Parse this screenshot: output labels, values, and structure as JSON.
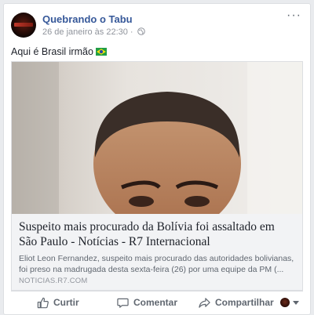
{
  "post": {
    "page_name": "Quebrando o Tabu",
    "timestamp": "26 de janeiro às 22:30",
    "separator": " · ",
    "audience_icon": "globe-icon",
    "caption": "Aqui é Brasil irmão",
    "caption_emoji": "brazil-flag-icon"
  },
  "link_card": {
    "title": "Suspeito mais procurado da Bolívia foi assaltado em São Paulo - Notícias - R7 Internacional",
    "description": "Eliot Leon Fernandez, suspeito mais procurado das autoridades bolivianas, foi preso na madrugada desta sexta-feira (26) por uma equipe da PM (...",
    "domain": "NOTICIAS.R7.COM"
  },
  "actions": {
    "like_label": "Curtir",
    "comment_label": "Comentar",
    "share_label": "Compartilhar"
  },
  "colors": {
    "link_blue": "#365899",
    "secondary_text": "#606770",
    "muted_text": "#90949c",
    "card_bg": "#f2f3f5"
  }
}
